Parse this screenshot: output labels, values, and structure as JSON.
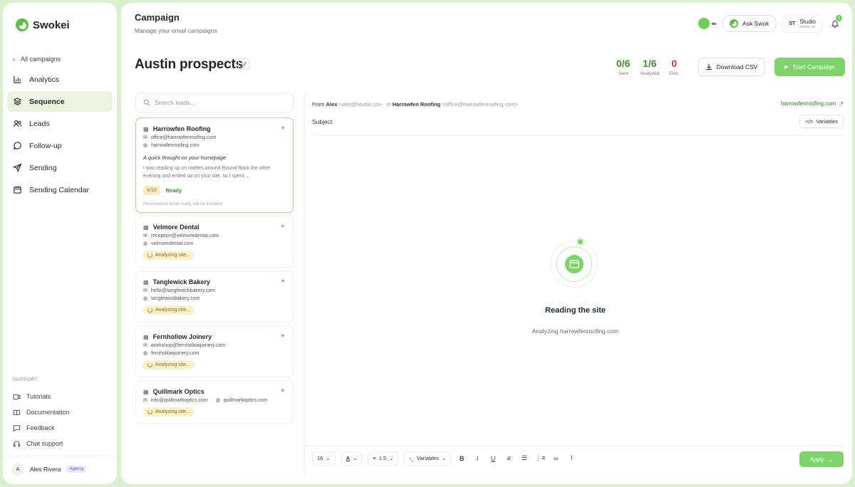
{
  "app": {
    "name": "Swokei"
  },
  "sidebar": {
    "back_label": "All campaigns",
    "items": [
      {
        "label": "Analytics",
        "icon": "bar-chart-icon"
      },
      {
        "label": "Sequence",
        "icon": "layers-icon",
        "active": true
      },
      {
        "label": "Leads",
        "icon": "users-icon"
      },
      {
        "label": "Follow-up",
        "icon": "chat-icon"
      },
      {
        "label": "Sending",
        "icon": "send-icon"
      },
      {
        "label": "Sending Calendar",
        "icon": "calendar-icon"
      }
    ],
    "support_label": "SUPPORT",
    "support": [
      {
        "label": "Tutorials"
      },
      {
        "label": "Documentation"
      },
      {
        "label": "Feedback"
      },
      {
        "label": "Chat support"
      }
    ],
    "user": {
      "initial": "A",
      "name": "Alex Rivera",
      "badge": "Agency"
    }
  },
  "header": {
    "title": "Campaign",
    "subtitle": "Manage your email campaigns",
    "credits": "∞",
    "ask_label": "Ask Swok",
    "workspace": {
      "initials": "ST",
      "name": "Studio",
      "sub": "studio.co"
    },
    "notifications": "4"
  },
  "campaign": {
    "name": "Austin prospects",
    "stats": [
      {
        "value": "0/6",
        "label": "Sent"
      },
      {
        "value": "1/6",
        "label": "Analyzed"
      },
      {
        "value": "0",
        "label": "Excl."
      }
    ],
    "download_label": "Download CSV",
    "start_label": "Start Campaign"
  },
  "leads": {
    "search_placeholder": "Search leads...",
    "items": [
      {
        "name": "Harrowfen Roofing",
        "email": "office@harrowfenroofing.com",
        "site": "harrowfenroofing.com",
        "subject": "A quick thought on your homepage",
        "preview": "I was reading up on roofers around Round Rock the other evening and ended up on your site, so I spent ...",
        "score": "6/10",
        "status": "Ready",
        "note": "Personalized email ready, will be included"
      },
      {
        "name": "Velmore Dental",
        "email": "reception@velmoredental.com",
        "site": "velmoredental.com",
        "status": "Analyzing site..."
      },
      {
        "name": "Tanglewick Bakery",
        "email": "hello@tanglewickbakery.com",
        "site": "tanglewickbakery.com",
        "status": "Analyzing site..."
      },
      {
        "name": "Fernhollow Joinery",
        "email": "workshop@fernhollowjoinery.com",
        "site": "fernhollowjoinery.com",
        "status": "Analyzing site..."
      },
      {
        "name": "Quillmark Optics",
        "email": "info@quillmarkoptics.com",
        "site": "quillmarkoptics.com",
        "status": "Analyzing site..."
      }
    ]
  },
  "editor": {
    "from_label": "From",
    "from_name": "Alex",
    "from_email": "<alex@studio.co>",
    "to_label": "· to",
    "to_name": "Harrowfen Roofing",
    "to_email": "<office@harrowfenroofing.com>",
    "site_link": "harrowfenroofing.com",
    "subject_label": "Subject",
    "variables_label": "Variables",
    "loading_title": "Reading the site",
    "loading_sub": "Analyzing harrowfenroofing.com",
    "toolbar": {
      "font_size": "16",
      "color_label": "A",
      "line_height": "1.5",
      "variables": "Variables",
      "apply": "Apply"
    }
  }
}
